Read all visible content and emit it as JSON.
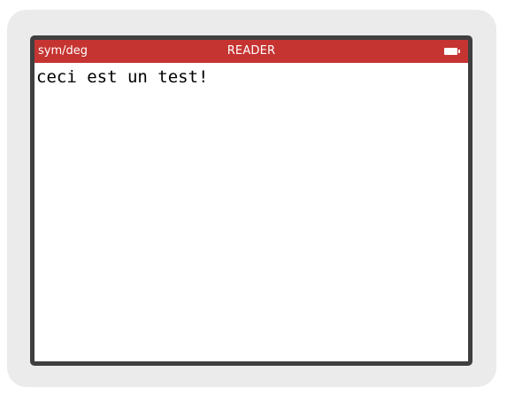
{
  "status_bar": {
    "mode": "sym/deg",
    "title": "READER",
    "battery_icon": "battery-full-icon"
  },
  "reader": {
    "content": "ceci est un test!"
  },
  "colors": {
    "status_bar_background": "#c53431",
    "device_shell": "#ebebeb",
    "screen_bezel": "#3f3f3f"
  }
}
